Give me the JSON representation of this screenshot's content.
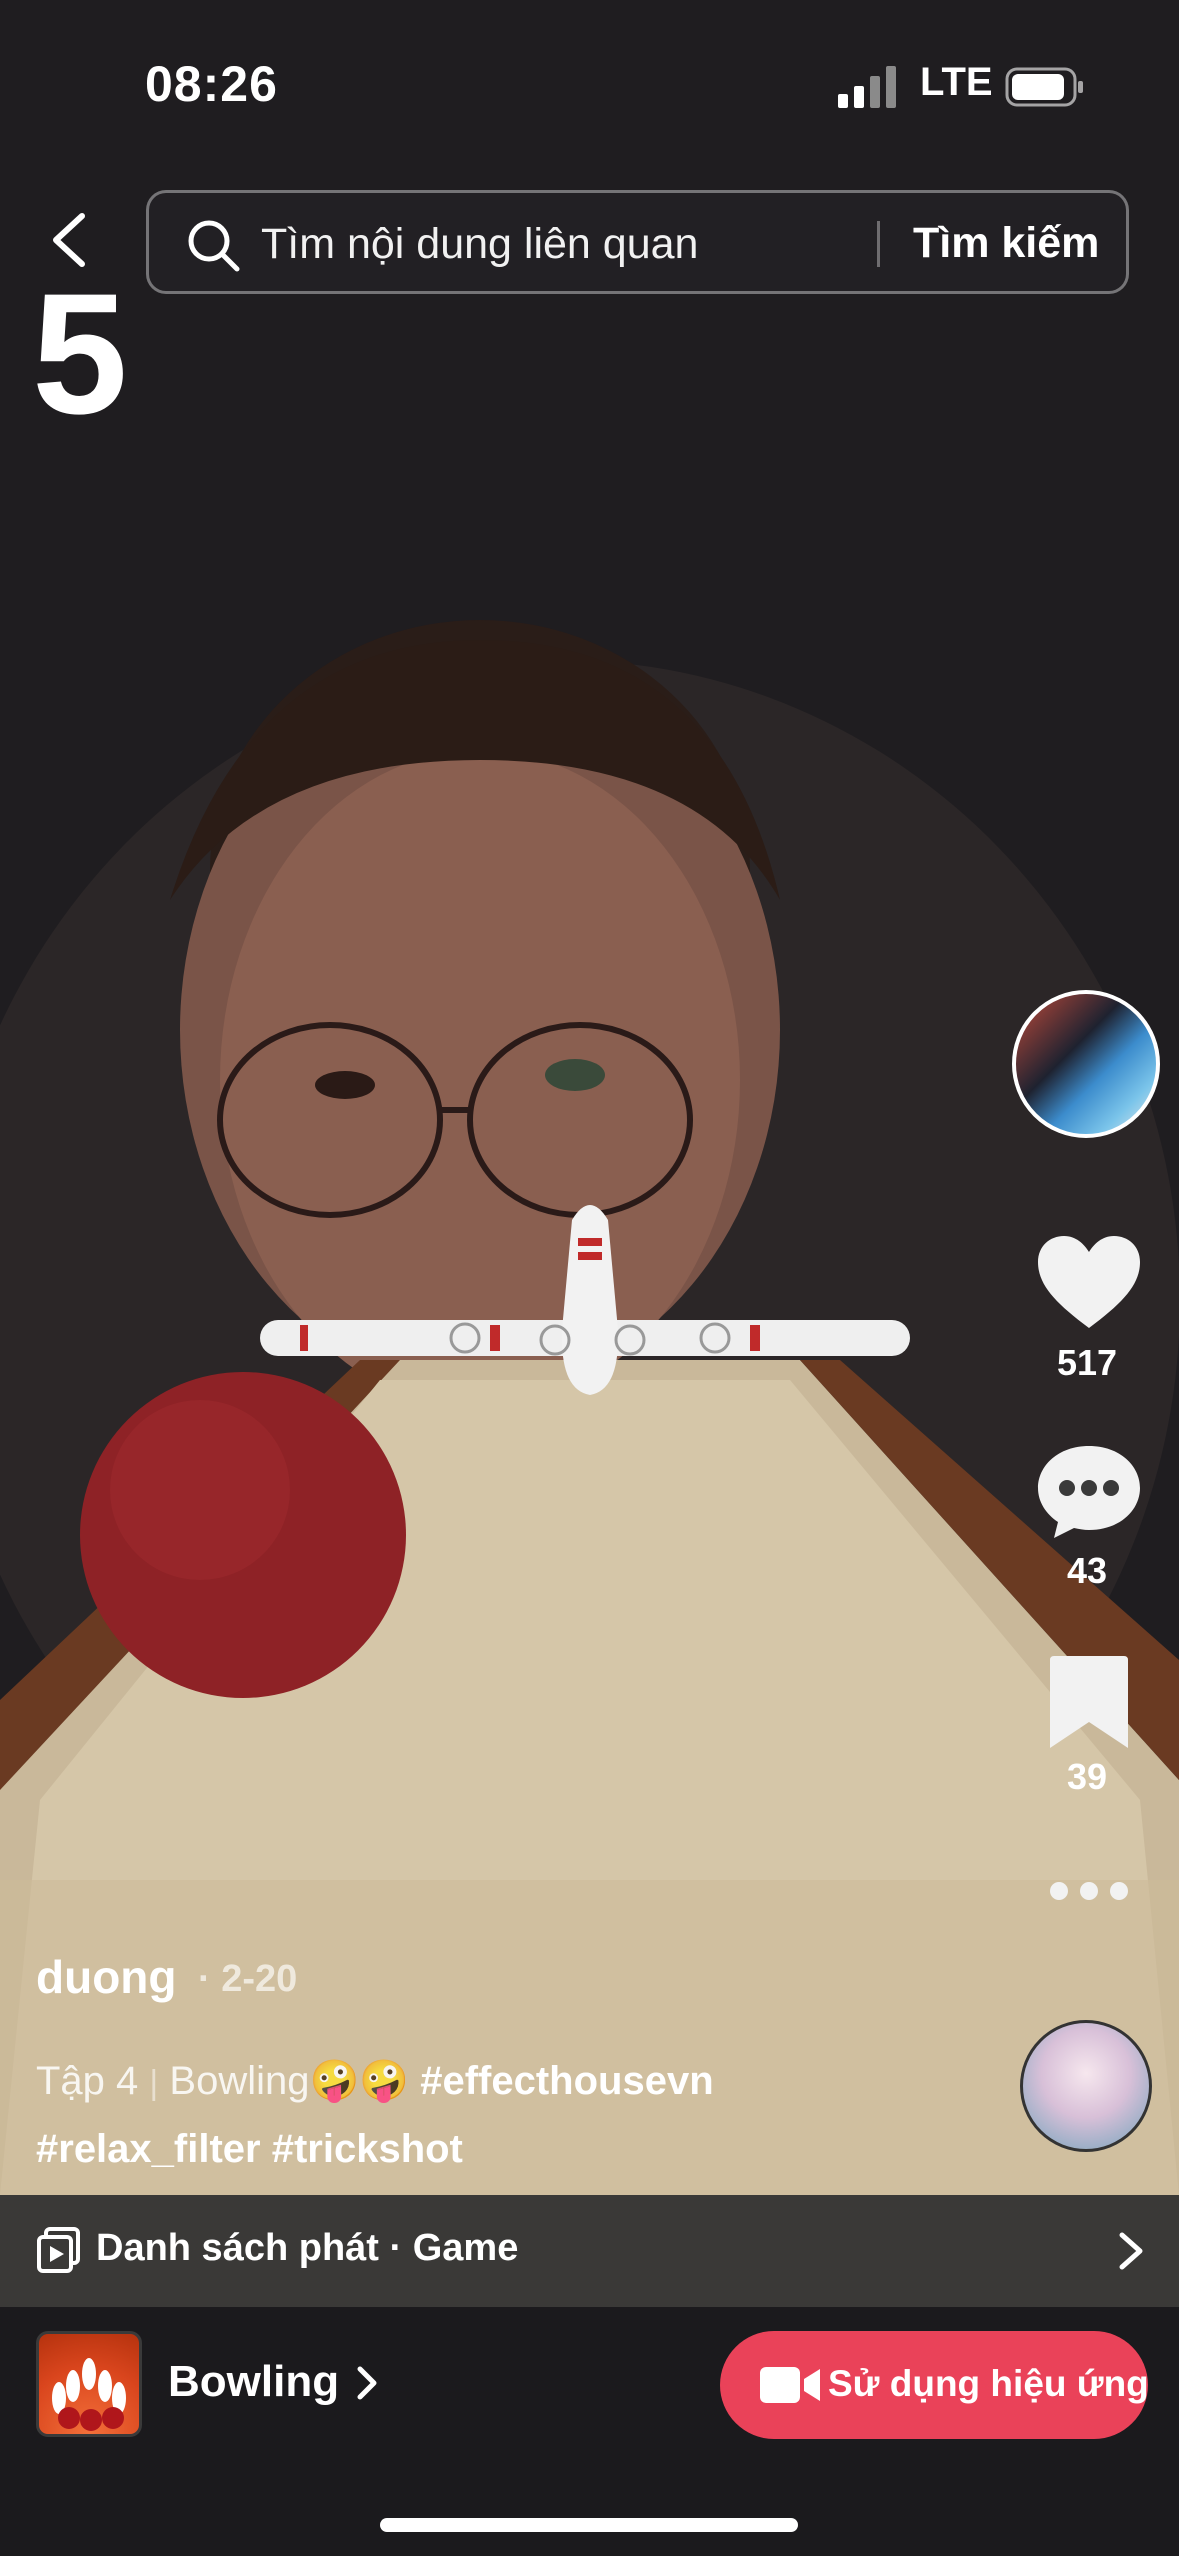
{
  "status_bar": {
    "time": "08:26",
    "network": "LTE"
  },
  "search": {
    "placeholder": "Tìm nội dung liên quan",
    "button": "Tìm kiếm"
  },
  "overlay_count": "5",
  "actions": {
    "likes": "517",
    "comments": "43",
    "saves": "39"
  },
  "post": {
    "username": "duong",
    "date": "· 2-20",
    "caption_prefix": "Tập 4",
    "caption_sep": "|",
    "caption_title": "Bowling🤪🤪",
    "caption_tags_1": "#effecthousevn",
    "caption_tags_2": "#relax_filter #trickshot"
  },
  "playlist": {
    "label": "Danh sách phát · Game"
  },
  "effect": {
    "name": "Bowling",
    "button": "Sử dụng hiệu ứng"
  },
  "colors": {
    "accent": "#ea4259",
    "playlist_bg": "#3a3937",
    "background": "#1b1a1d"
  },
  "icons": [
    "back-icon",
    "search-icon",
    "heart-icon",
    "comment-icon",
    "bookmark-icon",
    "more-icon",
    "playlist-icon",
    "chevron-right-icon",
    "video-camera-icon"
  ]
}
